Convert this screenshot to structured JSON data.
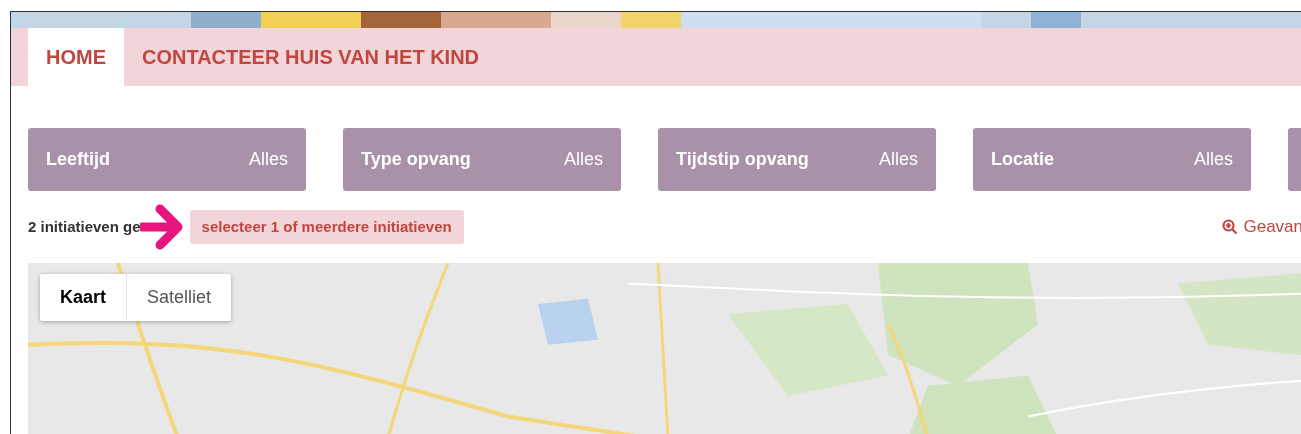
{
  "nav": {
    "tabs": [
      {
        "label": "HOME",
        "selected": true
      },
      {
        "label": "CONTACTEER HUIS VAN HET KIND",
        "selected": false
      }
    ]
  },
  "filters": [
    {
      "label": "Leeftijd",
      "value": "Alles"
    },
    {
      "label": "Type opvang",
      "value": "Alles"
    },
    {
      "label": "Tijdstip opvang",
      "value": "Alles"
    },
    {
      "label": "Locatie",
      "value": "Alles"
    }
  ],
  "results": {
    "count_text": "2 initiatieven ge",
    "hint": "selecteer 1 of meerdere initiatieven",
    "advanced_link": "Geavan"
  },
  "map": {
    "types": [
      {
        "label": "Kaart",
        "selected": true
      },
      {
        "label": "Satelliet",
        "selected": false
      }
    ]
  }
}
